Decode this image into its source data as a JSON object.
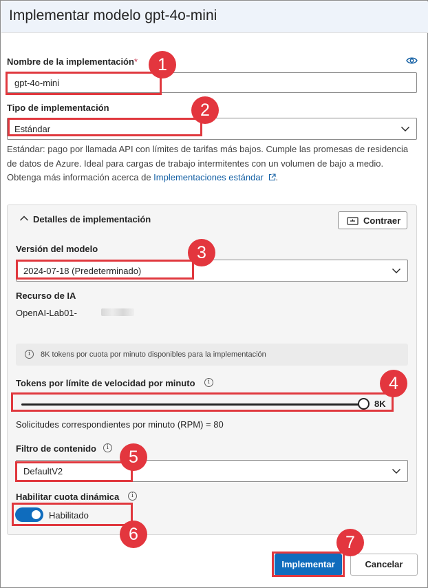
{
  "title": "Implementar modelo gpt-4o-mini",
  "deployment_name": {
    "label": "Nombre de la implementación",
    "required_mark": "*",
    "value": "gpt-4o-mini",
    "icon": "eye-icon"
  },
  "deployment_type": {
    "label": "Tipo de implementación",
    "value": "Estándar",
    "description": "Estándar: pago por llamada API con límites de tarifas más bajos. Cumple las promesas de residencia de datos de Azure. Ideal para cargas de trabajo intermitentes con un volumen de bajo a medio. Obtenga más información acerca de ",
    "link": "Implementaciones estándar"
  },
  "details": {
    "header": "Detalles de implementación",
    "collapse_button": "Contraer",
    "model_version": {
      "label": "Versión del modelo",
      "value": "2024-07-18 (Predeterminado)"
    },
    "ai_resource": {
      "label": "Recurso de IA",
      "value": "OpenAI-Lab01-"
    },
    "quota_info": "8K tokens por cuota por minuto disponibles para la implementación",
    "rate_limit": {
      "label": "Tokens por límite de velocidad por minuto",
      "value_label": "8K",
      "level": 1.0
    },
    "rpm_text": "Solicitudes correspondientes por minuto (RPM) = 80",
    "content_filter": {
      "label": "Filtro de contenido",
      "value": "DefaultV2"
    },
    "dynamic_quota": {
      "label": "Habilitar cuota dinámica",
      "state": "Habilitado",
      "on": true
    }
  },
  "buttons": {
    "deploy": "Implementar",
    "cancel": "Cancelar"
  },
  "annotations": [
    "1",
    "2",
    "3",
    "4",
    "5",
    "6",
    "7"
  ],
  "colors": {
    "accent": "#0f6cbd",
    "annotation": "#e3363e",
    "header_bg": "#eef3fa",
    "panel_bg": "#f5f5f5"
  }
}
